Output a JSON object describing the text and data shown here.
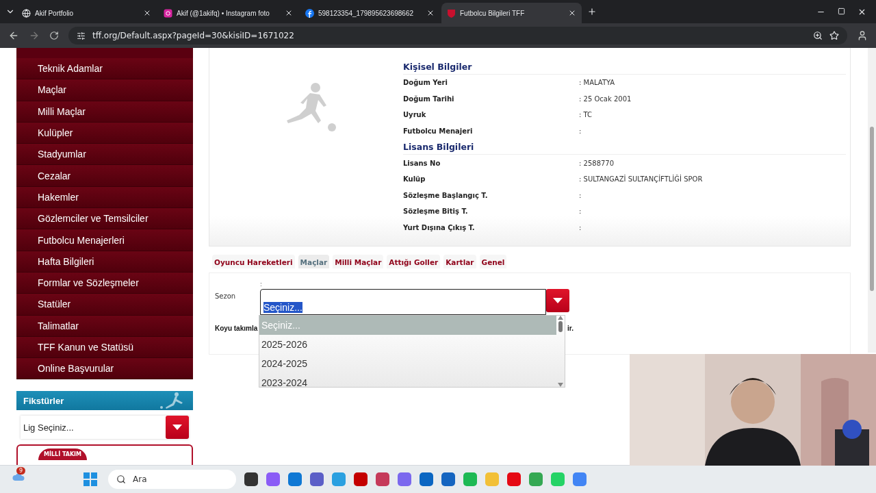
{
  "browser": {
    "tabs": [
      {
        "title": "Akif Portfolio",
        "selected": false
      },
      {
        "title": "Akif (@1akifq) • Instagram foto",
        "selected": false
      },
      {
        "title": "598123354_179895623698662",
        "selected": false
      },
      {
        "title": "Futbolcu Bilgileri TFF",
        "selected": true
      }
    ],
    "address": "tff.org/Default.aspx?pageId=30&kisiID=1671022"
  },
  "sidebar": {
    "items": [
      "Teknik Adamlar",
      "Maçlar",
      "Milli Maçlar",
      "Kulüpler",
      "Stadyumlar",
      "Cezalar",
      "Hakemler",
      "Gözlemciler ve Temsilciler",
      "Futbolcu Menajerleri",
      "Hafta Bilgileri",
      "Formlar ve Sözleşmeler",
      "Statüler",
      "Talimatlar",
      "TFF Kanun ve Statüsü",
      "Online Başvurular"
    ],
    "fixtures": {
      "title": "Fikstürler",
      "select": "Lig Seçiniz..."
    },
    "badge": "MİLLİ TAKIM"
  },
  "player": {
    "sections": [
      {
        "title": "Kişisel Bilgiler",
        "rows": [
          {
            "label": "Doğum Yeri",
            "value": ":  MALATYA"
          },
          {
            "label": "Doğum Tarihi",
            "value": ":  25 Ocak 2001"
          },
          {
            "label": "Uyruk",
            "value": ":  TC"
          },
          {
            "label": "Futbolcu Menajeri",
            "value": ":"
          }
        ]
      },
      {
        "title": "Lisans Bilgileri",
        "rows": [
          {
            "label": "Lisans No",
            "value": ": 2588770"
          },
          {
            "label": "Kulüp",
            "value": ": SULTANGAZİ SULTANÇİFTLİĞİ SPOR"
          },
          {
            "label": "Sözleşme Başlangıç T.",
            "value": ":"
          },
          {
            "label": "Sözleşme Bitiş T.",
            "value": ":"
          },
          {
            "label": "Yurt Dışına Çıkış T.",
            "value": ":"
          }
        ]
      }
    ]
  },
  "tabs": [
    {
      "label": "Oyuncu Hareketleri",
      "selected": false
    },
    {
      "label": "Maçlar",
      "selected": true
    },
    {
      "label": "Milli Maçlar",
      "selected": false
    },
    {
      "label": "Attığı Goller",
      "selected": false
    },
    {
      "label": "Kartlar",
      "selected": false
    },
    {
      "label": "Genel",
      "selected": false
    }
  ],
  "season": {
    "label": "Sezon",
    "colon": ":",
    "value": "Seçiniz...",
    "note_start": "Koyu takımla",
    "note_end": "ir.",
    "options": [
      {
        "label": "Seçiniz...",
        "selected": true
      },
      {
        "label": "2025-2026",
        "selected": false
      },
      {
        "label": "2024-2025",
        "selected": false
      },
      {
        "label": "2023-2024",
        "selected": false
      }
    ]
  },
  "taskbar": {
    "weather_badge": "9",
    "search": "Ara"
  }
}
